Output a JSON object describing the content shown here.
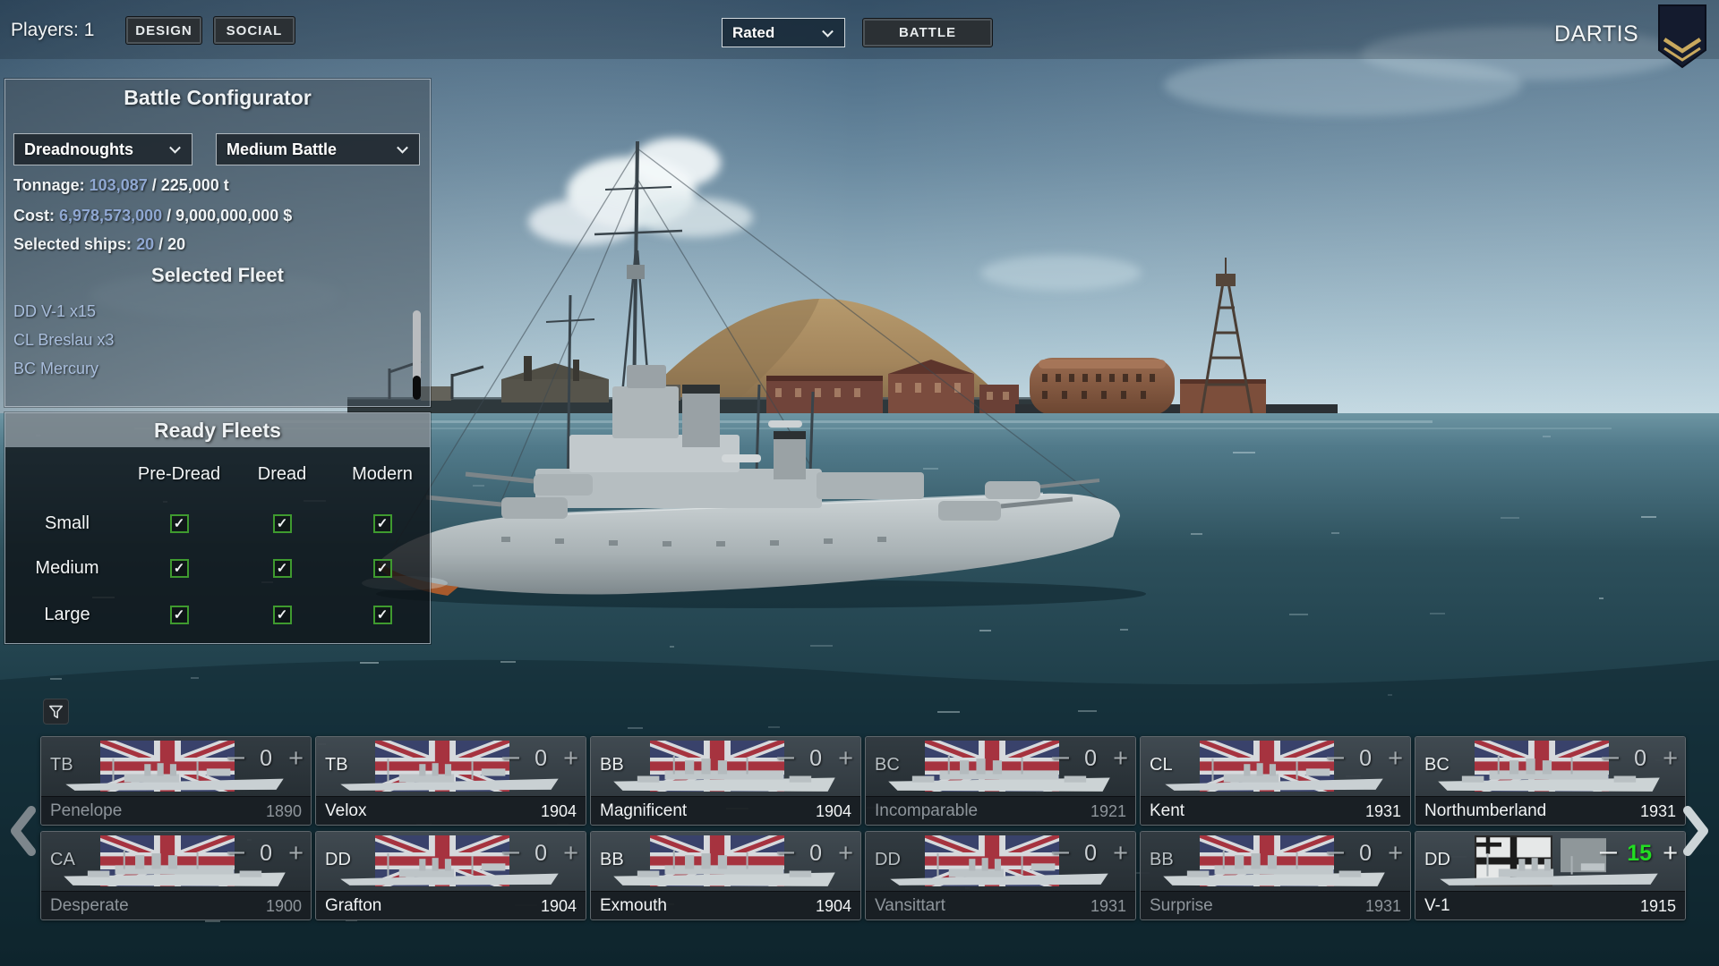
{
  "top_bar": {
    "players_label": "Players: 1",
    "design_button": "DESIGN",
    "social_button": "SOCIAL",
    "mode_select_value": "Rated",
    "battle_button": "BATTLE",
    "username": "DARTIS"
  },
  "battle_configurator": {
    "title": "Battle Configurator",
    "era_select_value": "Dreadnoughts",
    "size_select_value": "Medium Battle",
    "tonnage_label": "Tonnage: ",
    "tonnage_current": "103,087",
    "tonnage_rest": " / 225,000 t",
    "cost_label": "Cost: ",
    "cost_current": "6,978,573,000",
    "cost_rest": " / 9,000,000,000 $",
    "ships_label": "Selected ships: ",
    "ships_current": "20",
    "ships_rest": " / 20",
    "fleet_title": "Selected Fleet",
    "fleet_items": [
      "DD V-1 x15",
      "CL Breslau x3",
      "BC Mercury"
    ]
  },
  "ready_fleets": {
    "title": "Ready Fleets",
    "columns": [
      "Pre-Dread",
      "Dread",
      "Modern"
    ],
    "rows": [
      {
        "label": "Small",
        "checked": [
          true,
          true,
          true
        ]
      },
      {
        "label": "Medium",
        "checked": [
          true,
          true,
          true
        ]
      },
      {
        "label": "Large",
        "checked": [
          true,
          true,
          true
        ]
      }
    ],
    "check_glyph": "✓"
  },
  "ship_browser": {
    "cards": [
      {
        "type": "TB",
        "name": "Penelope",
        "year": "1890",
        "count": "0",
        "flag": "uk",
        "state": "dim"
      },
      {
        "type": "TB",
        "name": "Velox",
        "year": "1904",
        "count": "0",
        "flag": "uk",
        "state": "active"
      },
      {
        "type": "BB",
        "name": "Magnificent",
        "year": "1904",
        "count": "0",
        "flag": "uk",
        "state": "active"
      },
      {
        "type": "BC",
        "name": "Incomparable",
        "year": "1921",
        "count": "0",
        "flag": "uk",
        "state": "dim"
      },
      {
        "type": "CL",
        "name": "Kent",
        "year": "1931",
        "count": "0",
        "flag": "uk",
        "state": "active"
      },
      {
        "type": "BC",
        "name": "Northumberland",
        "year": "1931",
        "count": "0",
        "flag": "uk",
        "state": "active"
      },
      {
        "type": "CA",
        "name": "Desperate",
        "year": "1900",
        "count": "0",
        "flag": "uk",
        "state": "dim"
      },
      {
        "type": "DD",
        "name": "Grafton",
        "year": "1904",
        "count": "0",
        "flag": "uk",
        "state": "active"
      },
      {
        "type": "BB",
        "name": "Exmouth",
        "year": "1904",
        "count": "0",
        "flag": "uk",
        "state": "active"
      },
      {
        "type": "DD",
        "name": "Vansittart",
        "year": "1931",
        "count": "0",
        "flag": "uk",
        "state": "dim"
      },
      {
        "type": "BB",
        "name": "Surprise",
        "year": "1931",
        "count": "0",
        "flag": "uk",
        "state": "dim"
      },
      {
        "type": "DD",
        "name": "V-1",
        "year": "1915",
        "count": "15",
        "flag": "de",
        "state": "selected"
      }
    ]
  },
  "icons": {
    "minus_glyph": "−",
    "plus_glyph": "+",
    "filter": "funnel-icon",
    "prev": "chevron-left-icon",
    "next": "chevron-right-icon",
    "rank_badge": "rank-chevron-badge-icon",
    "dropdown": "chevron-down-icon"
  },
  "colors": {
    "stat_number_blue": "#8fa7d1",
    "fleet_link_blue": "#a9bedc",
    "checkbox_green": "#3f9a2f",
    "count_green": "#22dd22",
    "flag_red": "#a6333f",
    "flag_blue": "#39426b"
  }
}
